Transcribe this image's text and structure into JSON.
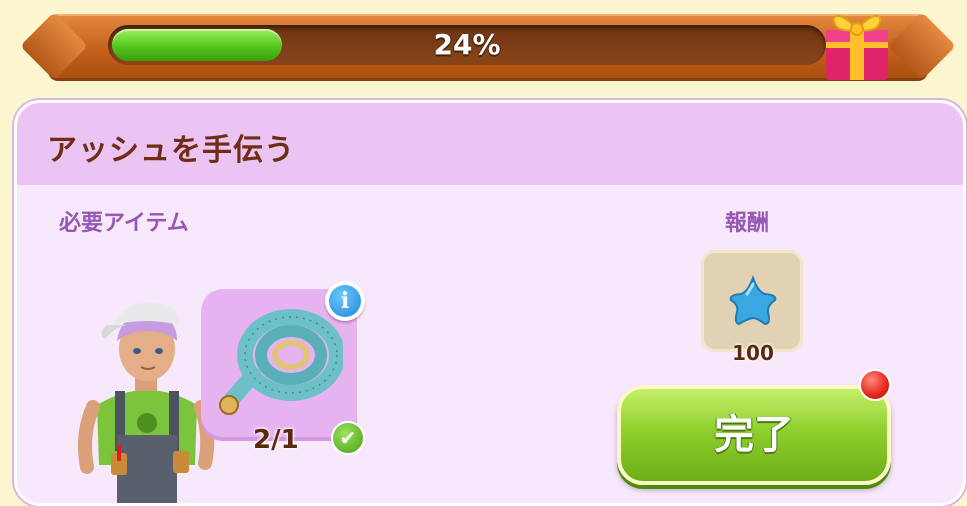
{
  "progress": {
    "percent_label": "24%",
    "fraction": 0.24
  },
  "quest": {
    "title": "アッシュを手伝う",
    "required_label": "必要アイテム",
    "reward_label": "報酬",
    "item": {
      "icon": "measuring-tape-icon",
      "count_label": "2/1",
      "completed": true
    },
    "reward": {
      "icon": "blue-star-icon",
      "amount": "100"
    },
    "complete_button_label": "完了"
  },
  "colors": {
    "progress_fill": "#54c61d",
    "banner": "#c5611c",
    "header": "#ebc4f3",
    "button": "#8fd02e"
  }
}
